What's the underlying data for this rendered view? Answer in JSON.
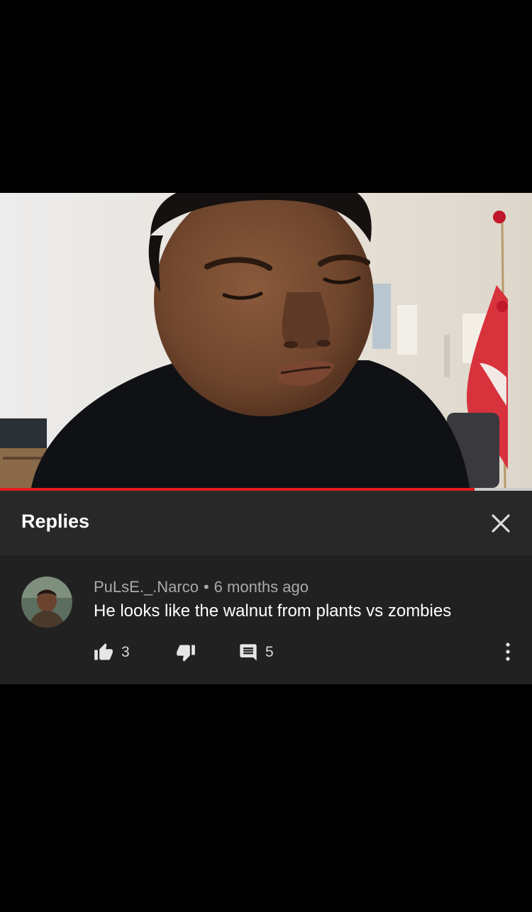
{
  "video": {
    "progress_fraction": 0.892
  },
  "replies_panel": {
    "title": "Replies",
    "close_icon": "close-icon"
  },
  "comment": {
    "author": "PuLsE._.Narco",
    "separator": "•",
    "time": "6 months ago",
    "text": "He looks like the walnut from plants vs zombies",
    "like_count": "3",
    "reply_count": "5",
    "icons": [
      "thumb-up-icon",
      "thumb-down-icon",
      "comment-icon",
      "more-vert-icon"
    ]
  },
  "colors": {
    "background": "#000000",
    "header_bg": "#282828",
    "comment_bg": "#212121",
    "progress_red": "#e21b1b",
    "meta_text": "#aaaaaa"
  }
}
